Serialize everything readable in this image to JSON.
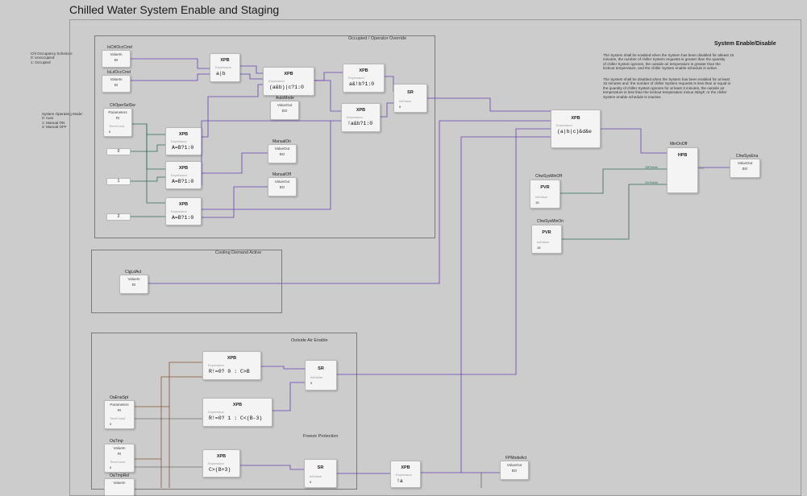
{
  "title": "Chilled Water System Enable and Staging",
  "notes": {
    "occ_schedule": "Chl Occupancy Schedule\n0: Unoccupied\n1: Occupied",
    "operating_mode": "System Operating Mode:\n0: Auto\n1: Manual ON\n2: Manual OFF"
  },
  "panels": {
    "occupied": "Occupied / Operator Override",
    "cooling": "Cooling Demand Active",
    "oa": "Outside Air Enable",
    "freeze": "Freeze Protection"
  },
  "enable_disable": {
    "title": "System Enable/Disable",
    "para1": "The System shall be enabled when the System has been disabled for atleast 15\nminutes, the number of chiller System requests is greater than the quantity\nof chiller System ignores, the outside air temperature is greater than the\nlockout temperature, and the chiller System enable schedule is active.",
    "para2": "The System shall be disabled when the System has been enabled for at least\n15 minutes and: the number of chiller System requests is less than or equal to\nthe quantity of chiller System ignores for at least 3 minutes, the outside air\ntemperature is less than the lockout temperature minus 3degF, or the chiller\nSystem enable schedule is inactive."
  },
  "blocks": {
    "IsChlOccCmd": {
      "name": "IsChlOccCmd",
      "type": "ValueIn",
      "sub": "BI"
    },
    "IsLdOccCmd": {
      "name": "IsLdOccCmd",
      "type": "ValueIn",
      "sub": "BI"
    },
    "ChOperSelSw": {
      "name": "ChOperSelSw",
      "type": "Parameters",
      "sub": "RI",
      "ts": "TimeConst",
      "val": "0"
    },
    "AutoMode": {
      "name": "AutoMode",
      "type": "ValueOut",
      "sub": "BO"
    },
    "ManualOn": {
      "name": "ManualOn",
      "type": "ValueOut",
      "sub": "BO"
    },
    "ManualOff": {
      "name": "ManualOff",
      "type": "ValueOut",
      "sub": "BO"
    },
    "ChlgLdAct": {
      "name": "ClgLdAct",
      "type": "ValueIn",
      "sub": "BI"
    },
    "MinOnOff": {
      "name": "MinOnOff",
      "type": "HPB"
    },
    "ChwSysEna": {
      "name": "ChwSysEna",
      "type": "ValueOut",
      "sub": "BO"
    },
    "ChwSysMinOff": {
      "name": "ChwSysMinOff",
      "type": "PVR",
      "sub": "InitValue",
      "val": "15"
    },
    "ChwSysMinOn": {
      "name": "ChwSysMinOn",
      "type": "PVR",
      "sub": "InitValue",
      "val": "15"
    },
    "OaEnaSpt": {
      "name": "OaEnaSpt",
      "type": "Parameters",
      "sub": "RI",
      "ts": "TimeConst",
      "val": "0"
    },
    "OaTmp": {
      "name": "OaTmp",
      "type": "ValueIn",
      "sub": "RI",
      "ts": "TimeConst",
      "val": "0"
    },
    "OaTmpRel": {
      "name": "OaTmpRel",
      "type": "ValueIn",
      "sub": "RI"
    },
    "FPModeAct": {
      "name": "FPModeAct",
      "type": "ValueOut",
      "sub": "BO"
    }
  },
  "xpb": [
    {
      "expr": "a|b"
    },
    {
      "expr": "(a&b)|c?1:0"
    },
    {
      "expr": "a&!b?1:0"
    },
    {
      "expr": "!a&b?1:0"
    },
    {
      "expr": "A=B?1:0"
    },
    {
      "expr": "A=B?1:0"
    },
    {
      "expr": "A=B?1:0"
    },
    {
      "expr": "(a|b|c)&d&e"
    },
    {
      "expr": "R!=0? 0 : C>B"
    },
    {
      "expr": "R!=0? 1 : C<(B-3)"
    },
    {
      "expr": "C>(B+3)"
    },
    {
      "expr": "!a"
    }
  ],
  "sr_labels": {
    "t": "SR",
    "s": "InitValue",
    "v": "0"
  },
  "constants": [
    "0",
    "1",
    "2"
  ],
  "labels": {
    "xpb": "XPB",
    "expression": "Expression",
    "offtodo": "OffToMin",
    "ontodo": "OnToMin",
    "out": "Out"
  }
}
